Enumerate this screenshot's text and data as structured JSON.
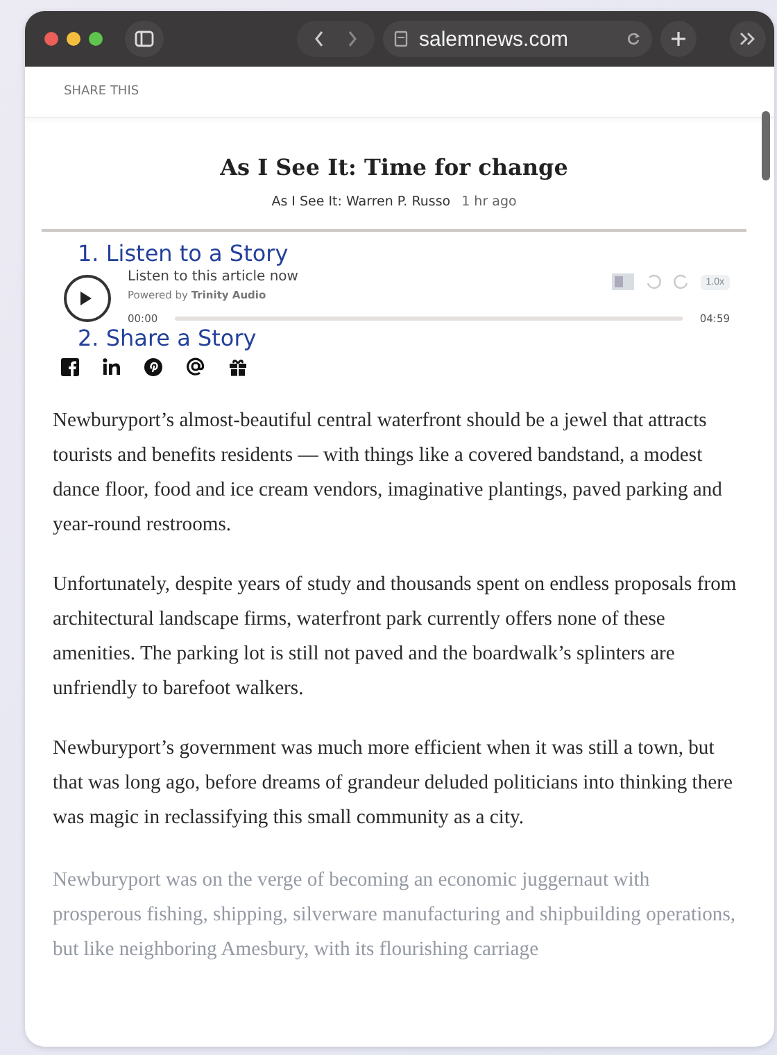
{
  "browser": {
    "address": "salemnews.com"
  },
  "share_bar": {
    "label": "SHARE THIS"
  },
  "article": {
    "title": "As I See It: Time for change",
    "byline": "As I See It: Warren P. Russo",
    "time": "1 hr ago"
  },
  "listen_heading": "1. Listen to a Story",
  "player": {
    "title": "Listen to this article now",
    "powered": "Powered by **Trinity Audio**",
    "speed": "1.0x",
    "elapsed": "00:00",
    "duration": "04:59",
    "level": 0
  },
  "share_heading": "2. Share a Story",
  "share_icons": [
    {
      "kind": "facebook"
    },
    {
      "kind": "linkedin"
    },
    {
      "kind": "pinterest"
    },
    {
      "kind": "email"
    },
    {
      "kind": "gift"
    }
  ],
  "paragraphs": [
    {
      "text": "Newburyport’s almost-beautiful central waterfront should be a jewel that attracts tourists and benefits residents — with things like a covered bandstand, a modest dance floor, food and ice cream vendors, imaginative plantings, paved parking and year-round restrooms.",
      "faded": false
    },
    {
      "text": "Unfortunately, despite years of study and thousands spent on endless proposals from architectural landscape firms, waterfront park currently offers none of these amenities. The parking lot is still not paved and the boardwalk’s splinters are unfriendly to barefoot walkers.",
      "faded": false
    },
    {
      "text": "Newburyport’s government was much more efficient when it was still a town, but that was long ago, before dreams of grandeur deluded politicians into thinking there was magic in reclassifying this small community as a city.",
      "faded": false
    },
    {
      "text": "Newburyport was on the verge of becoming an economic juggernaut with prosperous fishing, shipping, silverware manufacturing and shipbuilding operations, but like neighboring Amesbury, with its flourishing carriage",
      "faded": true
    }
  ]
}
